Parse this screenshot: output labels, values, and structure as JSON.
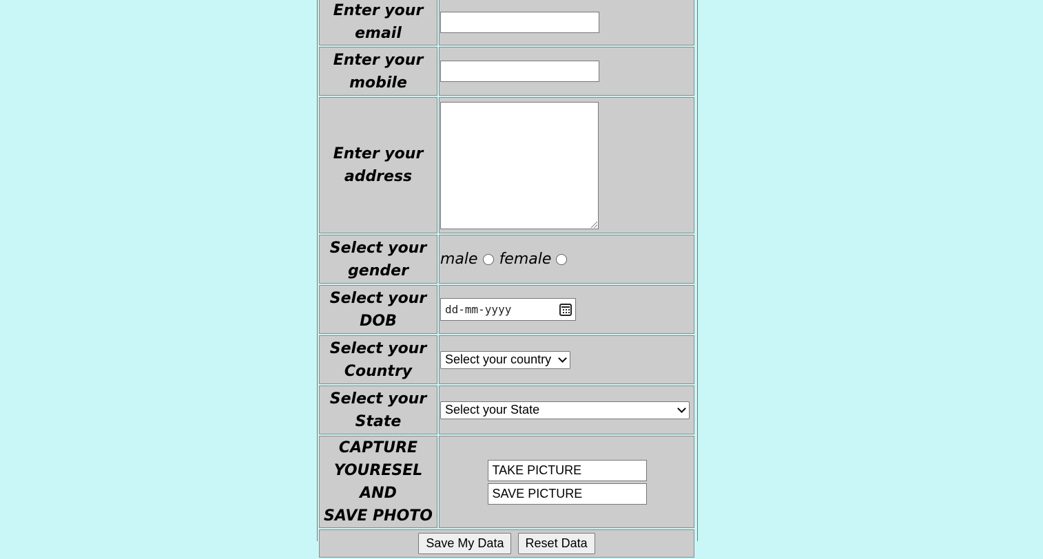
{
  "form": {
    "email": {
      "label_line1": "Enter your",
      "label_line2": "email",
      "value": ""
    },
    "mobile": {
      "label_line1": "Enter your",
      "label_line2": "mobile",
      "value": ""
    },
    "address": {
      "label_line1": "Enter your",
      "label_line2": "address",
      "value": ""
    },
    "gender": {
      "label_line1": "Select your",
      "label_line2": "gender",
      "options": [
        "male",
        "female"
      ],
      "selected": null
    },
    "dob": {
      "label_line1": "Select your",
      "label_line2": "DOB",
      "placeholder": "dd-mm-yyyy"
    },
    "country": {
      "label_line1": "Select your",
      "label_line2": "Country",
      "selected": "Select your country"
    },
    "state": {
      "label_line1": "Select your",
      "label_line2": "State",
      "selected": "Select your State"
    },
    "photo": {
      "label_line1": "CAPTURE",
      "label_line2": "YOURESEL AND",
      "label_line3": "SAVE PHOTO",
      "take_picture": "TAKE PICTURE",
      "save_picture": "SAVE PICTURE"
    },
    "actions": {
      "save_label": "Save My Data",
      "reset_label": "Reset Data"
    }
  },
  "colors": {
    "page_background": "#c9f7f7",
    "cell_background": "#cccccc"
  }
}
